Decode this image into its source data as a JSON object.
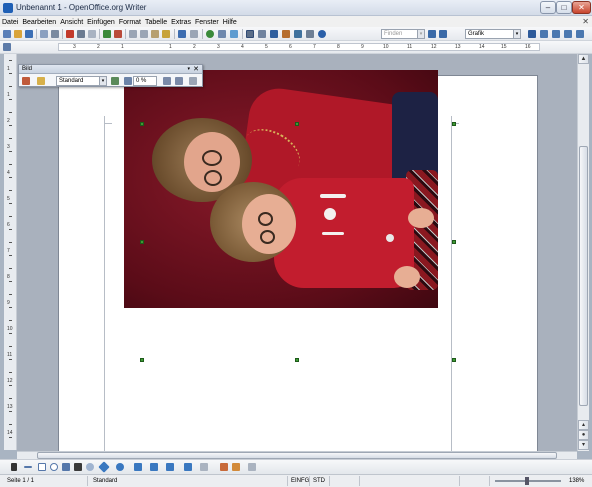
{
  "window": {
    "title": "Unbenannt 1 - OpenOffice.org Writer"
  },
  "menu": [
    "Datei",
    "Bearbeiten",
    "Ansicht",
    "Einfügen",
    "Format",
    "Tabelle",
    "Extras",
    "Fenster",
    "Hilfe"
  ],
  "toolbar": {
    "find_placeholder": "Finden",
    "style_value": "Grafik"
  },
  "ruler_h": [
    "3",
    "2",
    "1",
    "1",
    "2",
    "3",
    "4",
    "5",
    "6",
    "7",
    "8",
    "9",
    "10",
    "11",
    "12",
    "13",
    "14",
    "15",
    "16",
    "17"
  ],
  "ruler_v": [
    "1",
    "1",
    "2",
    "3",
    "4",
    "5",
    "6",
    "7",
    "8",
    "9",
    "10",
    "11",
    "12",
    "13",
    "14"
  ],
  "bild_toolbar": {
    "title": "Bild",
    "filter_mode": "Standard",
    "transparency": "0 %"
  },
  "statusbar": {
    "page": "Seite 1 / 1",
    "style": "Standard",
    "insert_mode": "EINFG",
    "selection_mode": "STD",
    "zoom": "138%"
  },
  "colors": {
    "selection_handle": "#3e9b34",
    "accent": "#1f5fb5"
  }
}
